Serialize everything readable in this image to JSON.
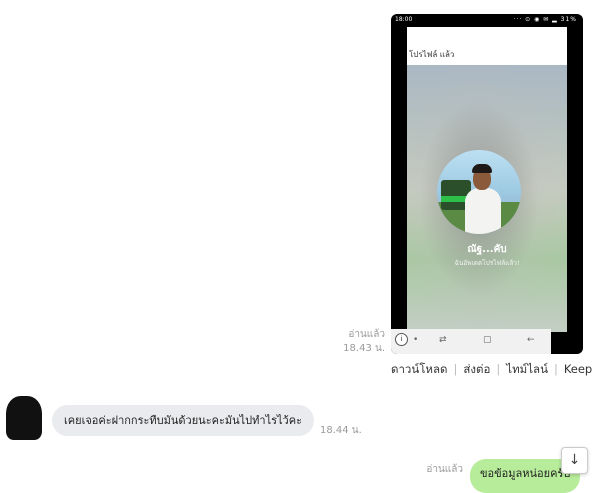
{
  "image_message": {
    "phone_time": "18:00",
    "phone_status_icons": "··· ⊙ ◉ ✉ ▂ 31%",
    "header_title": "โปรไฟล์ แล้ว",
    "profile_name": "ณัฐ...คับ",
    "profile_status": "ฉันอัพเดตโปรไฟล์แล้ว!",
    "nav_icons": [
      "i",
      "•",
      "⇄",
      "▢",
      "←"
    ],
    "read_label": "อ่านแล้ว",
    "time": "18.43 น."
  },
  "actions": {
    "download": "ดาวน์โหลด",
    "share": "ส่งต่อ",
    "timeline": "ไทม์ไลน์",
    "keep": "Keep"
  },
  "received_message": {
    "text": "เคยเจอค่ะฝากกระทืบมันด้วยนะคะมันไปทำไรไว้คะ",
    "time": "18.44 น."
  },
  "sent_message": {
    "read_label": "อ่านแล้ว",
    "text": "ขอข้อมูลหน่อยครับ"
  },
  "scroll_down_icon": "↓"
}
